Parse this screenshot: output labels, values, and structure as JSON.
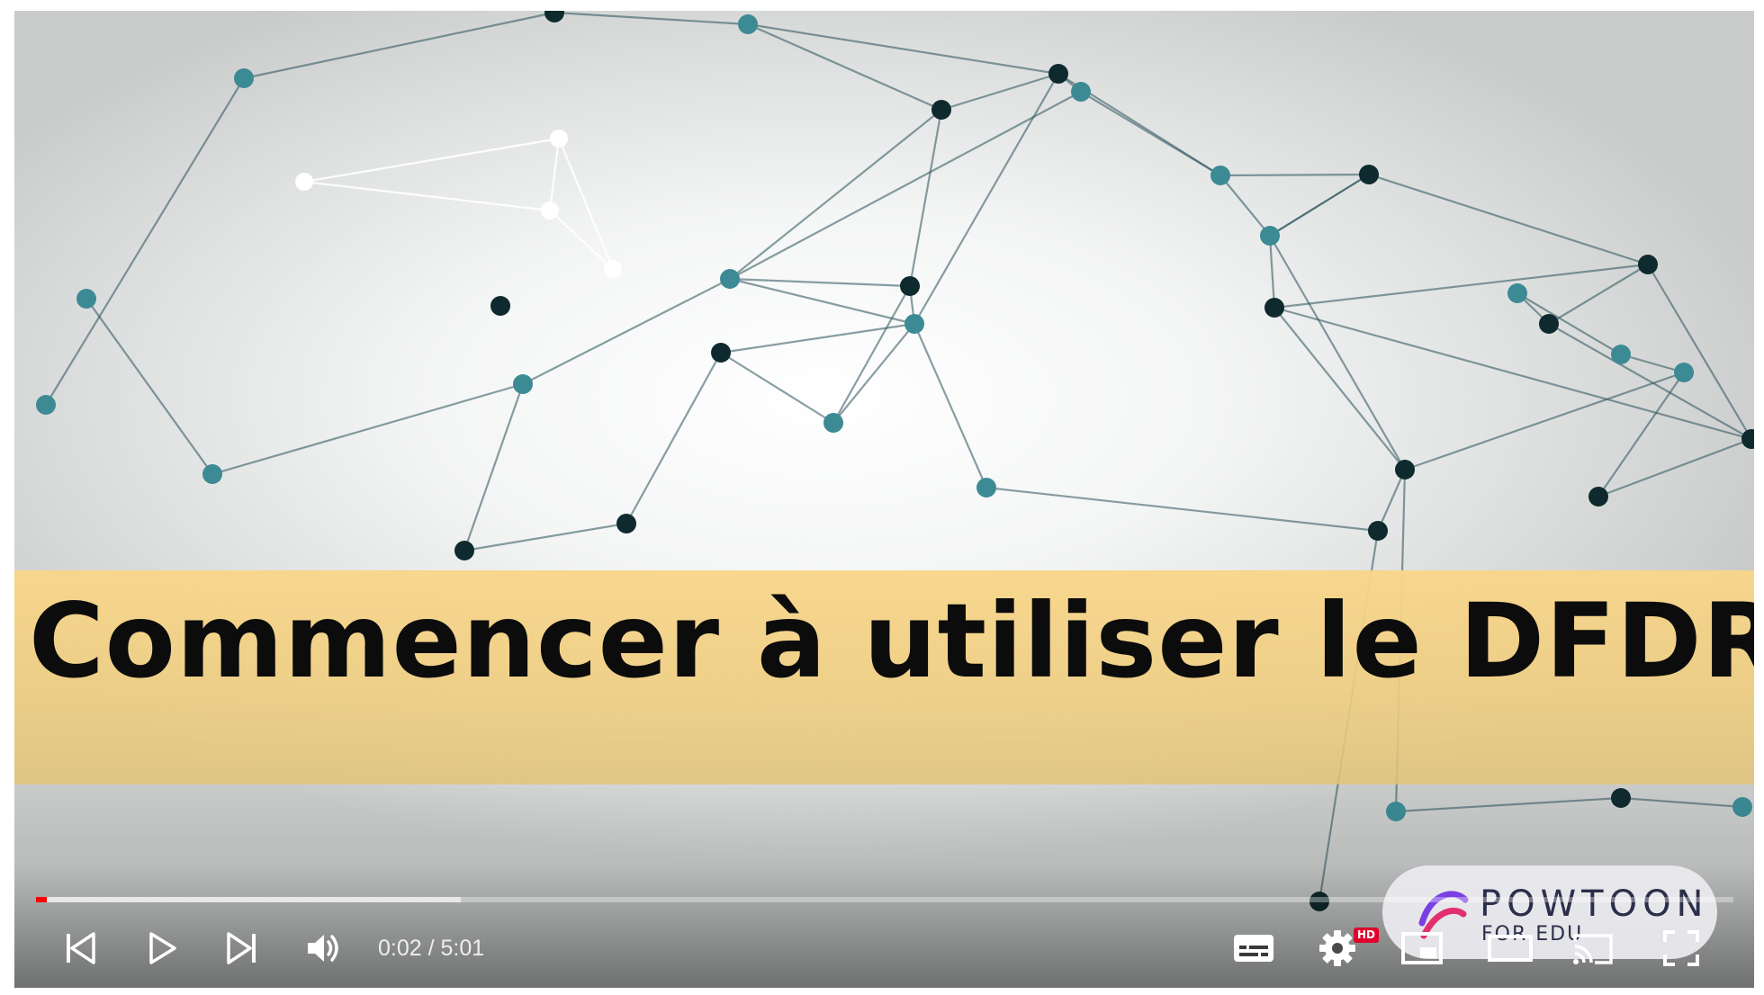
{
  "video": {
    "title": "Commencer à utiliser le DFDR"
  },
  "watermark": {
    "brand": "POWTOON",
    "sub": "FOR EDU"
  },
  "progress": {
    "played_fraction": 0.0066,
    "buffered_fraction": 0.25
  },
  "controls": {
    "current_time": "0:02",
    "duration": "5:01",
    "time_separator": " / ",
    "time_display": "0:02 / 5:01",
    "settings_badge": "HD",
    "icons": {
      "previous": "previous-icon",
      "play": "play-icon",
      "next": "next-icon",
      "volume": "volume-icon",
      "subtitles": "subtitles-icon",
      "settings": "gear-icon",
      "miniplayer": "miniplayer-icon",
      "theater": "theater-mode-icon",
      "cast": "cast-icon",
      "fullscreen": "fullscreen-icon"
    }
  },
  "colors": {
    "progress_played": "#ff0000",
    "title_band": "#f6d48a",
    "hd_badge": "#e1002d"
  }
}
